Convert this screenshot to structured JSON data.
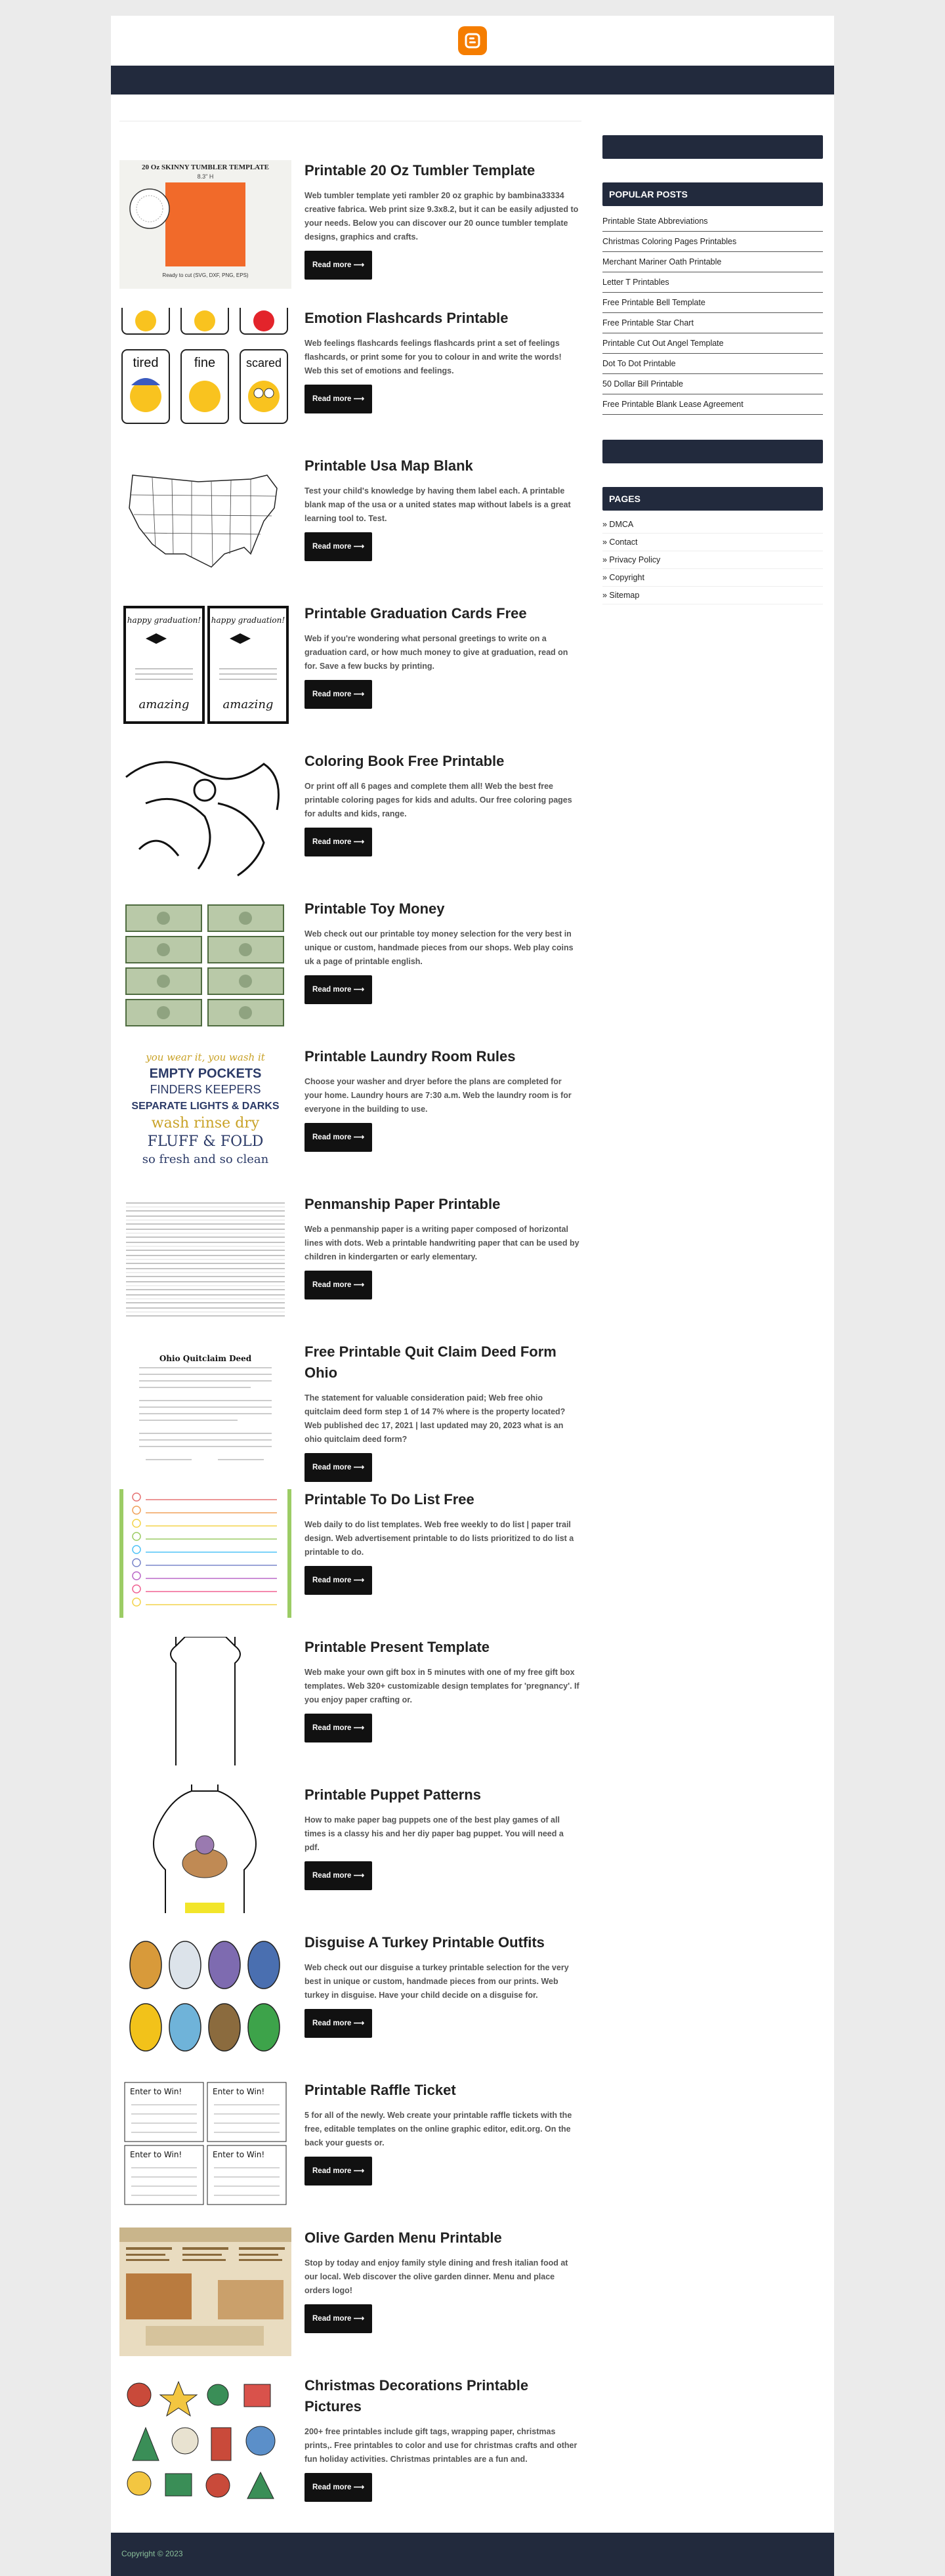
{
  "posts": [
    {
      "title": "Printable 20 Oz Tumbler Template",
      "desc": "Web tumbler template yeti rambler 20 oz graphic by bambina33334 creative fabrica. Web print size 9.3x8.2, but it can be easily adjusted to your needs. Below you can discover our 20 ounce tumbler template designs, graphics and crafts.",
      "btn": "Read more ⟶"
    },
    {
      "title": "Emotion Flashcards Printable",
      "desc": "Web feelings flashcards feelings flashcards print a set of feelings flashcards, or print some for you to colour in and write the words! Web this set of emotions and feelings.",
      "btn": "Read more ⟶",
      "thumb": {
        "words": [
          "tired",
          "fine",
          "scared"
        ]
      }
    },
    {
      "title": "Printable Usa Map Blank",
      "desc": "Test your child's knowledge by having them label each. A printable blank map of the usa or a united states map without labels is a great learning tool to. Test.",
      "btn": "Read more ⟶"
    },
    {
      "title": "Printable Graduation Cards Free",
      "desc": "Web if you're wondering what personal greetings to write on a graduation card, or how much money to give at graduation, read on for. Save a few bucks by printing.",
      "btn": "Read more ⟶",
      "thumb": {
        "cards": [
          "happy graduation!",
          "happy graduation!"
        ],
        "word": "amazing"
      }
    },
    {
      "title": "Coloring Book Free Printable",
      "desc": "Or print off all 6 pages and complete them all! Web the best free printable coloring pages for kids and adults. Our free coloring pages for adults and kids, range.",
      "btn": "Read more ⟶"
    },
    {
      "title": "Printable Toy Money",
      "desc": "Web check out our printable toy money selection for the very best in unique or custom, handmade pieces from our shops. Web play coins uk a page of printable english.",
      "btn": "Read more ⟶"
    },
    {
      "title": "Printable Laundry Room Rules",
      "desc": "Choose your washer and dryer before the plans are completed for your home. Laundry hours are 7:30 a.m. Web the laundry room is for everyone in the building to use.",
      "btn": "Read more ⟶",
      "thumb": {
        "lines": [
          "you wear it, you wash it",
          "EMPTY POCKETS",
          "FINDERS KEEPERS",
          "SEPARATE LIGHTS & DARKS",
          "wash rinse dry",
          "FLUFF & FOLD",
          "so fresh and so clean"
        ]
      }
    },
    {
      "title": "Penmanship Paper Printable",
      "desc": "Web a penmanship paper is a writing paper composed of horizontal lines with dots. Web a printable handwriting paper that can be used by children in kindergarten or early elementary.",
      "btn": "Read more ⟶"
    },
    {
      "title": "Free Printable Quit Claim Deed Form Ohio",
      "desc": "The statement for valuable consideration paid; Web free ohio quitclaim deed form step 1 of 14 7% where is the property located? Web published dec 17, 2021 | last updated may 20, 2023 what is an ohio quitclaim deed form?",
      "btn": "Read more ⟶",
      "thumb": {
        "heading": "Ohio Quitclaim Deed"
      }
    },
    {
      "title": "Printable To Do List Free",
      "desc": "Web daily to do list templates. Web free weekly to do list | paper trail design. Web advertisement printable to do lists prioritized to do list a printable to do.",
      "btn": "Read more ⟶"
    },
    {
      "title": "Printable Present Template",
      "desc": "Web make your own gift box in 5 minutes with one of my free gift box templates. Web 320+ customizable design templates for 'pregnancy'. If you enjoy paper crafting or.",
      "btn": "Read more ⟶"
    },
    {
      "title": "Printable Puppet Patterns",
      "desc": "How to make paper bag puppets one of the best play games of all times is a classy his and her diy paper bag puppet. You will need a pdf.",
      "btn": "Read more ⟶"
    },
    {
      "title": "Disguise A Turkey Printable Outfits",
      "desc": "Web check out our disguise a turkey printable selection for the very best in unique or custom, handmade pieces from our prints. Web turkey in disguise. Have your child decide on a disguise for.",
      "btn": "Read more ⟶"
    },
    {
      "title": "Printable Raffle Ticket",
      "desc": "5 for all of the newly. Web create your printable raffle tickets with the free, editable templates on the online graphic editor, edit.org. On the back your guests or.",
      "btn": "Read more ⟶",
      "thumb": {
        "label": "Enter to Win!"
      }
    },
    {
      "title": "Olive Garden Menu Printable",
      "desc": "Stop by today and enjoy family style dining and fresh italian food at our local. Web discover the olive garden dinner. Menu and place orders logo!",
      "btn": "Read more ⟶"
    },
    {
      "title": "Christmas Decorations Printable Pictures",
      "desc": "200+ free printables include gift tags, wrapping paper, christmas prints,. Free printables to color and use for christmas crafts and other fun holiday activities. Christmas printables are a fun and.",
      "btn": "Read more ⟶"
    }
  ],
  "tumbler_thumb": {
    "heading": "20 Oz SKINNY TUMBLER TEMPLATE",
    "width_label": "8.3\" H",
    "footer": "Ready to cut (SVG, DXF, PNG, EPS)"
  },
  "sidebar": {
    "popular_title": "POPULAR POSTS",
    "popular": [
      "Printable State Abbreviations",
      "Christmas Coloring Pages Printables",
      "Merchant Mariner Oath Printable",
      "Letter T Printables",
      "Free Printable Bell Template",
      "Free Printable Star Chart",
      "Printable Cut Out Angel Template",
      "Dot To Dot Printable",
      "50 Dollar Bill Printable",
      "Free Printable Blank Lease Agreement"
    ],
    "pages_title": "PAGES",
    "pages": [
      "» DMCA",
      "» Contact",
      "» Privacy Policy",
      "» Copyright",
      "» Sitemap"
    ]
  },
  "footer": {
    "copyright": "Copyright © 2023"
  },
  "colors": {
    "nav": "#222a3d",
    "accent": "#f57d00",
    "button": "#111111"
  },
  "icons": {
    "logo": "blogger-icon"
  }
}
